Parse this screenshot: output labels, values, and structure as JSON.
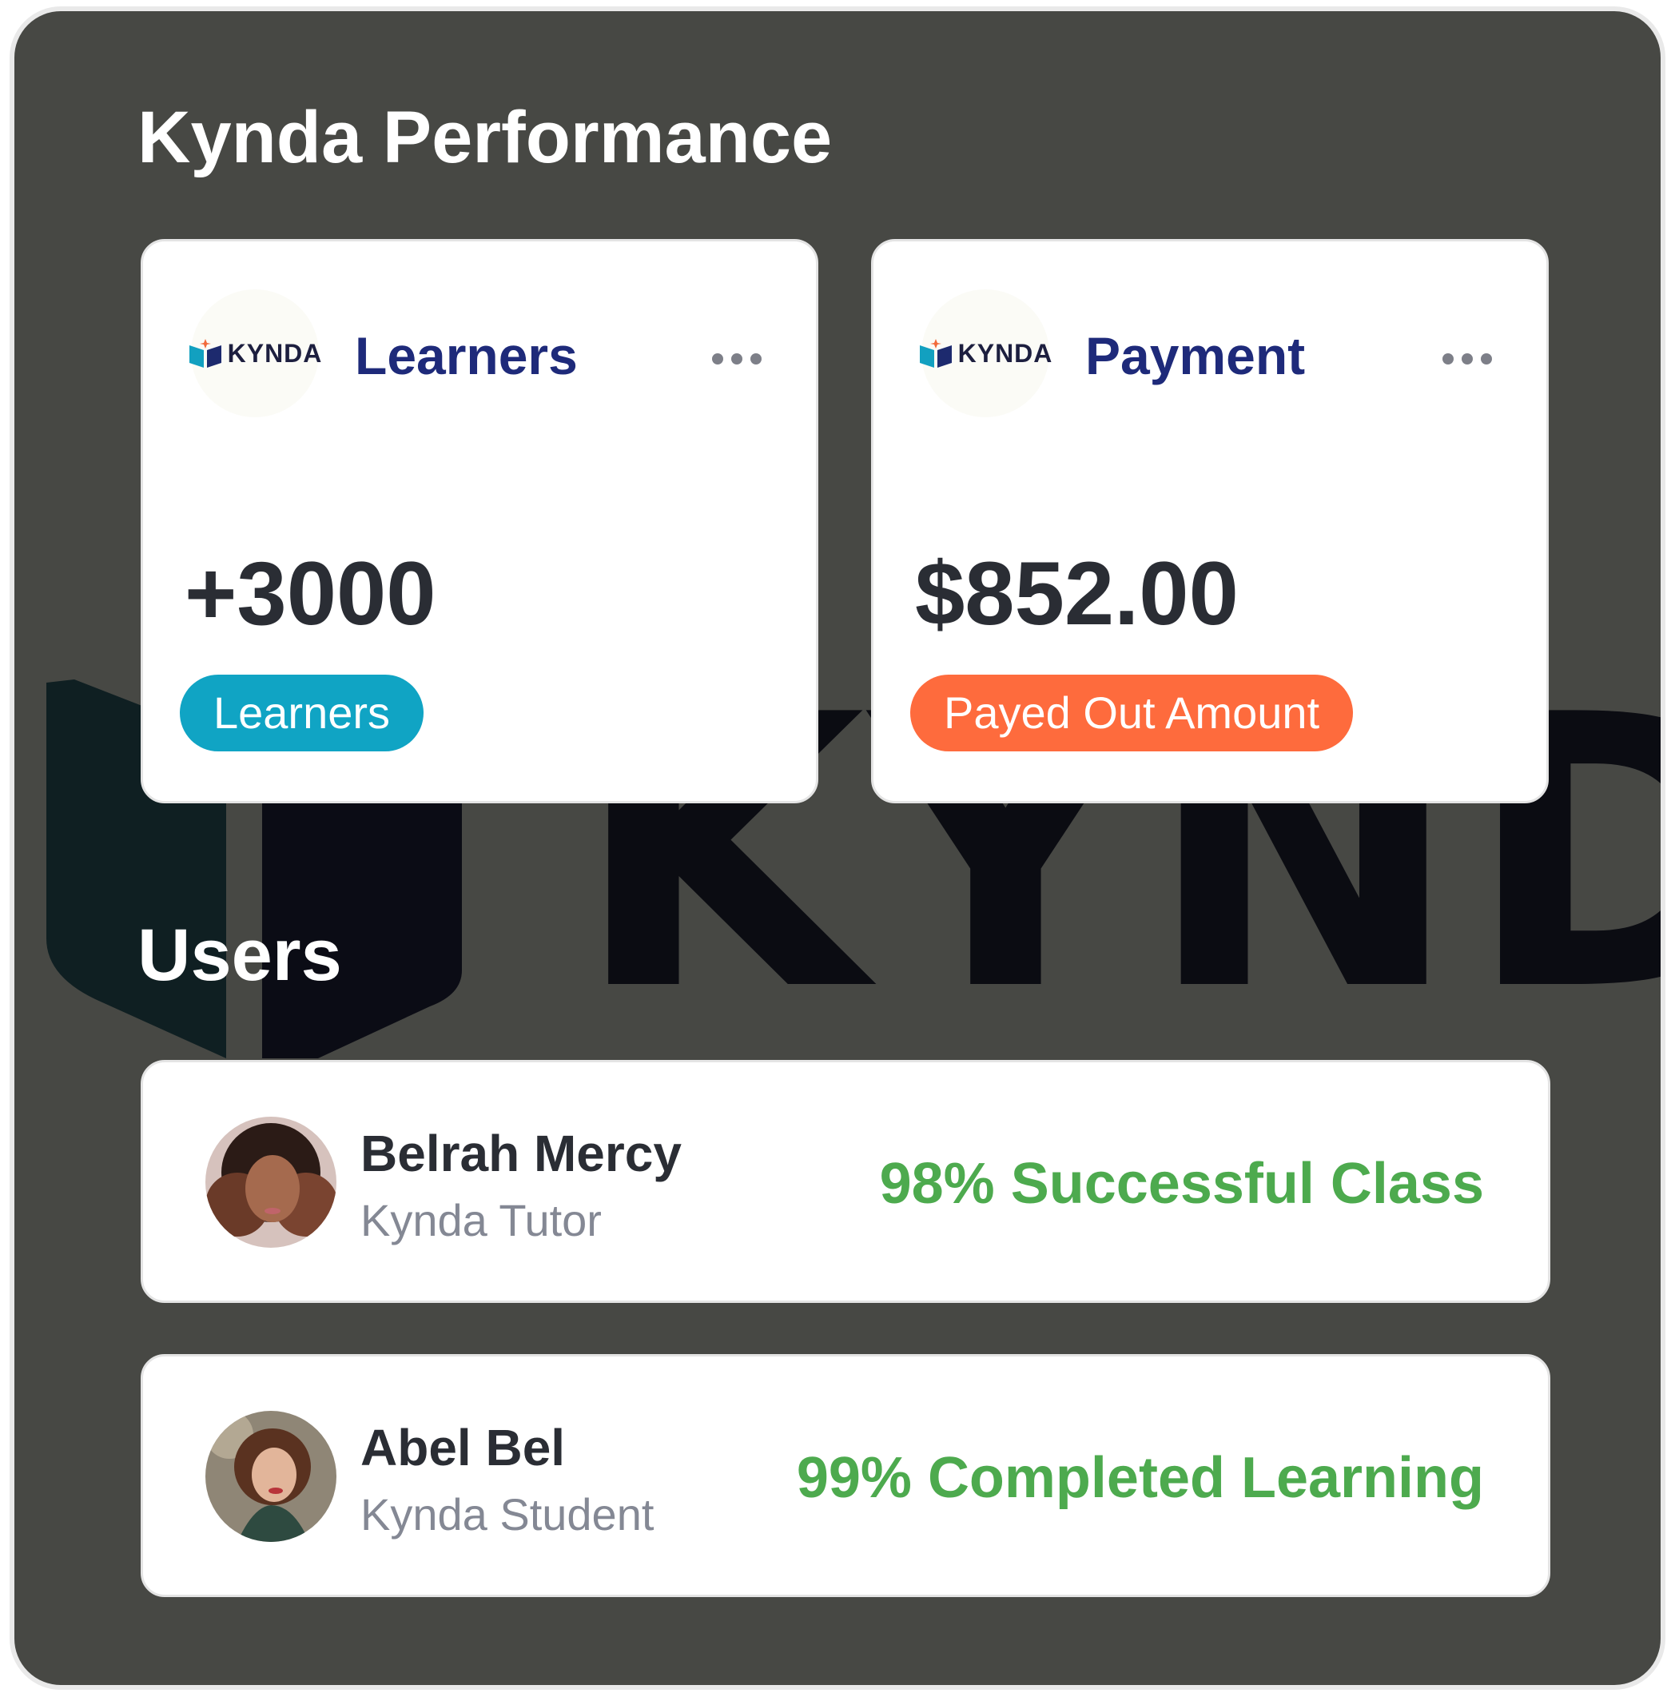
{
  "header": {
    "title": "Kynda Performance"
  },
  "watermark": {
    "text": "KYNDA"
  },
  "stats": [
    {
      "logo_text": "KYNDA",
      "title": "Learners",
      "value": "+3000",
      "badge": "Learners",
      "badge_color": "#10a4c4"
    },
    {
      "logo_text": "KYNDA",
      "title": "Payment",
      "value": "$852.00",
      "badge": "Payed Out Amount",
      "badge_color": "#fe6b3d"
    }
  ],
  "users_section": {
    "title": "Users"
  },
  "users": [
    {
      "name": "Belrah Mercy",
      "role": "Kynda Tutor",
      "metric": "98% Successful Class"
    },
    {
      "name": "Abel Bel",
      "role": "Kynda Student",
      "metric": "99% Completed Learning"
    }
  ],
  "colors": {
    "background": "#474844",
    "title_blue": "#1e2a7a",
    "success_green": "#4daa4e"
  }
}
